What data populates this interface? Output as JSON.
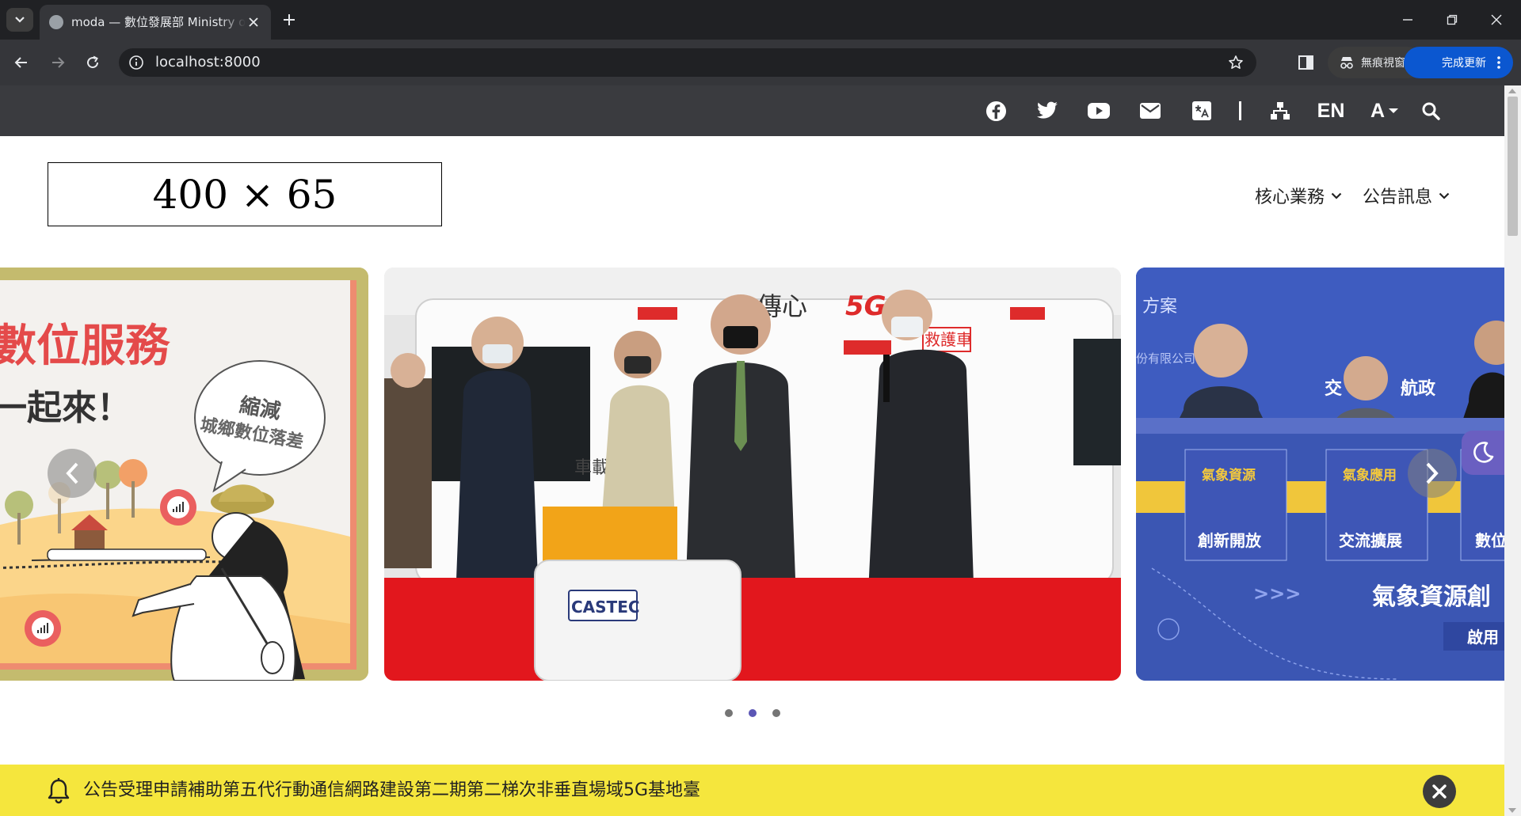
{
  "browser": {
    "tab_title": "moda — 數位發展部 Ministry of Digital Affairs",
    "url": "localhost:8000",
    "incognito_label": "無痕視窗",
    "update_label": "完成更新"
  },
  "topbar": {
    "icons": [
      "facebook-icon",
      "twitter-icon",
      "youtube-icon",
      "mail-icon",
      "translate-icon",
      "sitemap-icon",
      "search-icon"
    ],
    "lang_label": "EN",
    "font_size_label": "A"
  },
  "header": {
    "logo_placeholder": "400 × 65",
    "nav": [
      {
        "label": "核心業務"
      },
      {
        "label": "公告訊息"
      }
    ]
  },
  "carousel": {
    "slides": [
      {
        "texts": [
          "數位服務",
          "一起來！",
          "縮減",
          "城鄉數位落差"
        ]
      },
      {
        "texts": [
          "傳心",
          "5G",
          "救護車",
          "車載",
          "CASTEC"
        ]
      },
      {
        "texts": [
          "方案",
          "份有限公司",
          "交",
          "航政",
          "氣象資源",
          "氣象應用",
          "創新開放",
          "交流擴展",
          "數位",
          "氣象資源創",
          "啟用"
        ]
      }
    ],
    "dots_count": 3,
    "active_dot": 1
  },
  "notice": {
    "text": "公告受理申請補助第五代行動通信網路建設第二期第二梯次非垂直場域5G基地臺"
  },
  "colors": {
    "topbar": "#3a3b3f",
    "notice": "#f5e63d",
    "accent": "#5b56b5"
  }
}
